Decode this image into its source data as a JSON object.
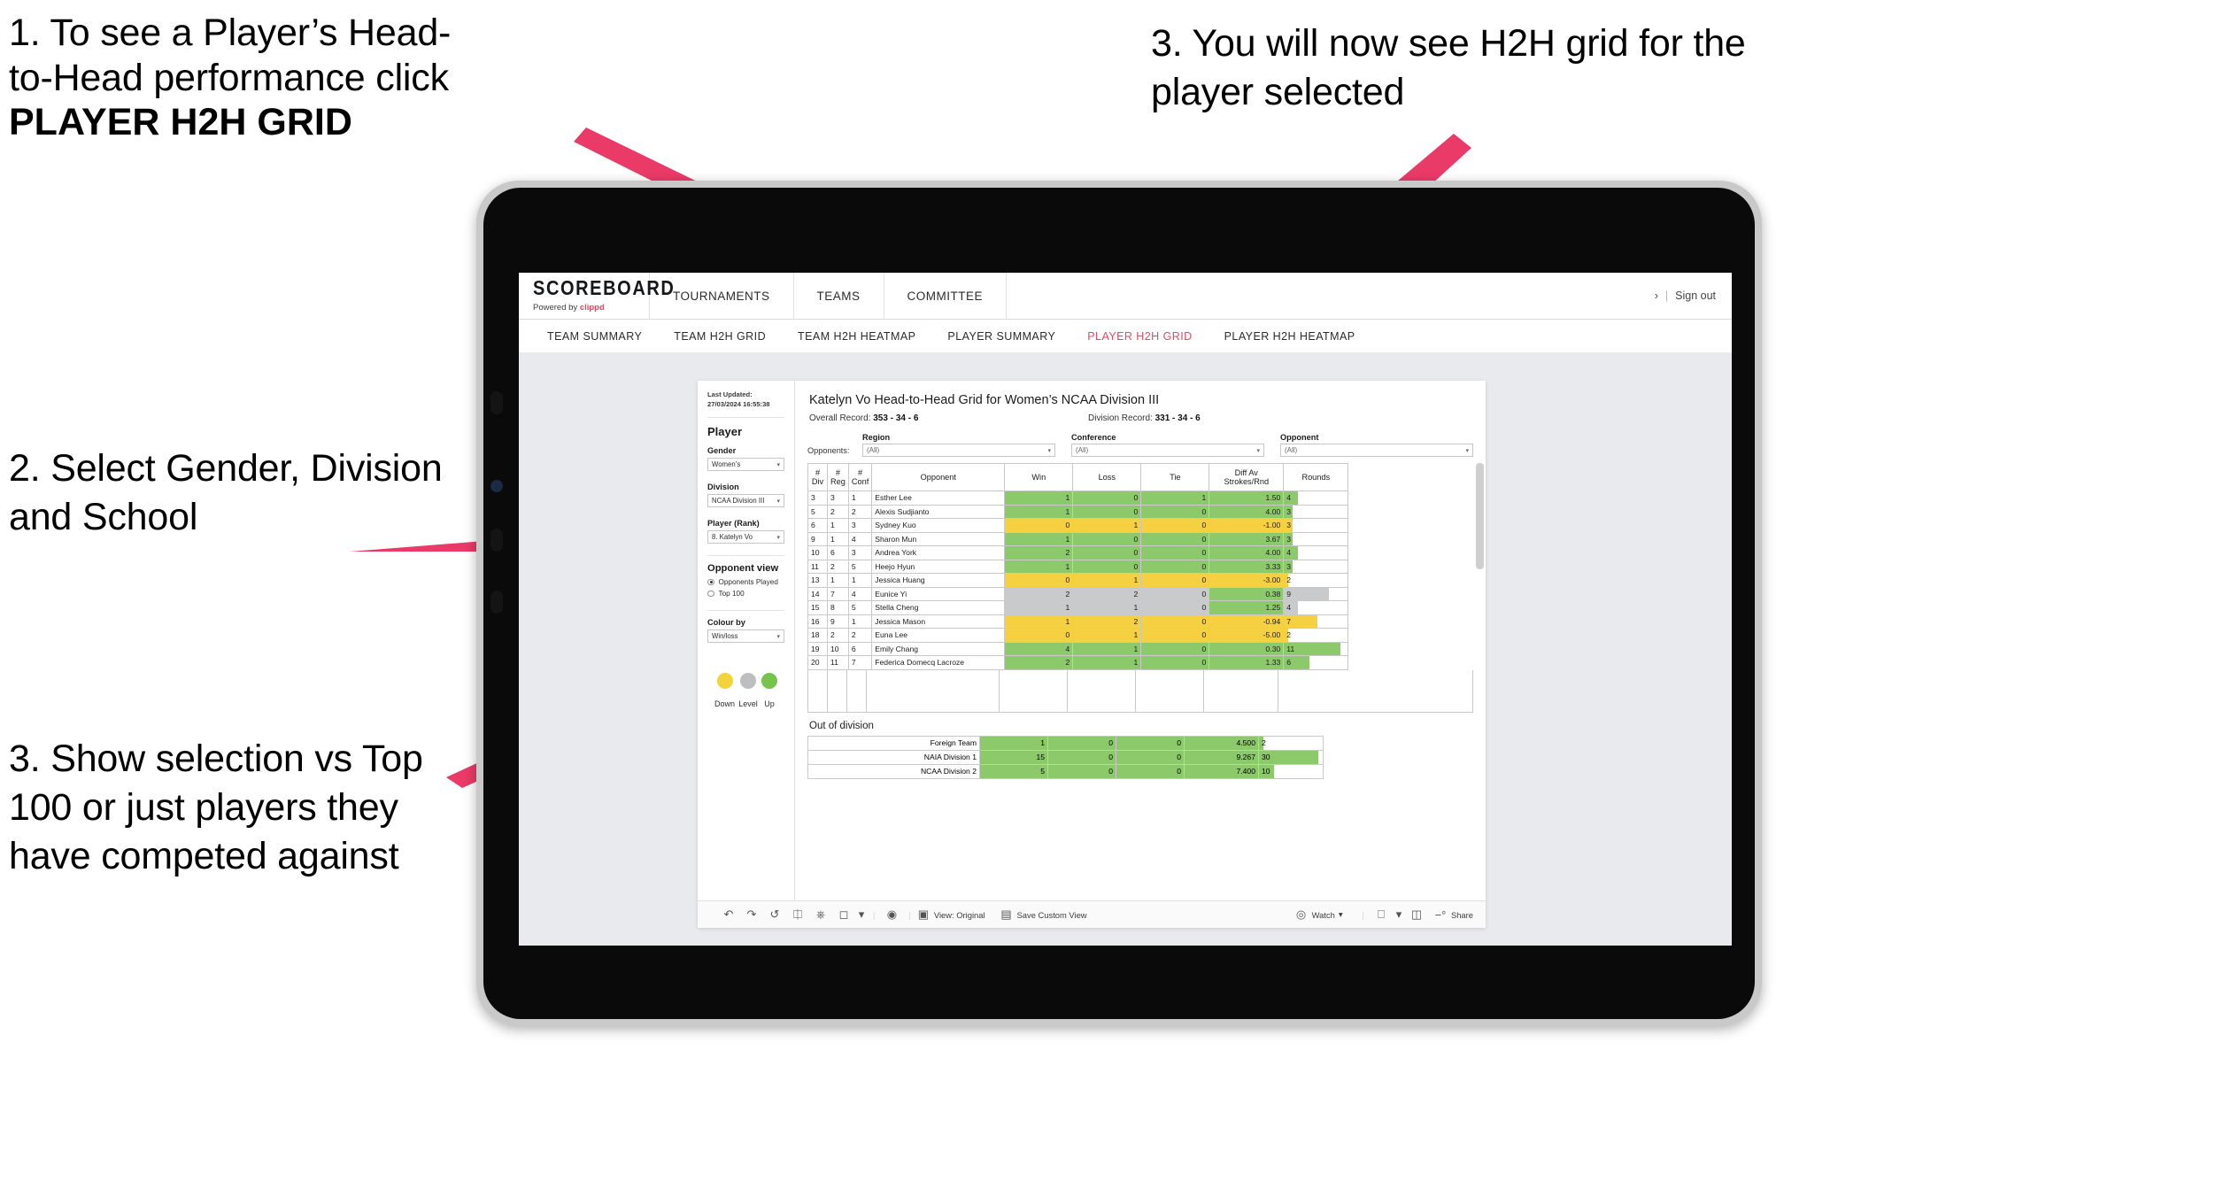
{
  "annotations": {
    "note1_line1": "1. To see a Player’s Head-",
    "note1_line2": "to-Head performance click",
    "note1_bold": "PLAYER H2H GRID",
    "note2": "2. Select Gender, Division and School",
    "note3_left": "3. Show selection vs Top 100 or just players they have competed against",
    "note3_top": "3. You will now see H2H grid for the player selected",
    "arrow_color": "#ea3a68"
  },
  "app": {
    "logo_main": "SCOREBOARD",
    "logo_sub_prefix": "Powered by",
    "logo_sub_brand": "clippd",
    "topnav": [
      "TOURNAMENTS",
      "TEAMS",
      "COMMITTEE"
    ],
    "account_chevron": "›",
    "account_sep": "|",
    "sign_out": "Sign out",
    "subnav": [
      {
        "label": "TEAM SUMMARY",
        "active": false
      },
      {
        "label": "TEAM H2H GRID",
        "active": false
      },
      {
        "label": "TEAM H2H HEATMAP",
        "active": false
      },
      {
        "label": "PLAYER SUMMARY",
        "active": false
      },
      {
        "label": "PLAYER H2H GRID",
        "active": true
      },
      {
        "label": "PLAYER H2H HEATMAP",
        "active": false
      }
    ],
    "active_tab_color": "#ec4464"
  },
  "sidebar": {
    "last_updated": "Last Updated: 27/03/2024 16:55:38",
    "player_heading": "Player",
    "gender_label": "Gender",
    "gender_value": "Women’s",
    "division_label": "Division",
    "division_value": "NCAA Division III",
    "player_label": "Player (Rank)",
    "player_value": "8. Katelyn Vo",
    "opponent_view_heading": "Opponent view",
    "radio_opponents_played": "Opponents Played",
    "radio_top100": "Top 100",
    "colour_by_label": "Colour by",
    "colour_by_value": "Win/loss",
    "legend": [
      {
        "label": "Down",
        "color": "#f2d33c"
      },
      {
        "label": "Level",
        "color": "#bcbec0"
      },
      {
        "label": "Up",
        "color": "#76c34e"
      }
    ],
    "chevron": "▾"
  },
  "main": {
    "title": "Katelyn Vo Head-to-Head Grid for Women’s NCAA Division III",
    "overall_label": "Overall Record:",
    "overall_value": "353 - 34 - 6",
    "division_label": "Division Record:",
    "division_value": "331 - 34 - 6",
    "opponents_label": "Opponents:",
    "filters": [
      {
        "label": "Region",
        "value": "(All)"
      },
      {
        "label": "Conference",
        "value": "(All)"
      },
      {
        "label": "Opponent",
        "value": "(All)"
      }
    ],
    "out_of_division_label": "Out of division"
  },
  "chart_data": {
    "type": "table",
    "title": "Katelyn Vo Head-to-Head Grid for Women’s NCAA Division III",
    "columns": [
      "# Div",
      "# Reg",
      "# Conf",
      "Opponent",
      "Win",
      "Loss",
      "Tie",
      "Diff Av Strokes/Rnd",
      "Rounds"
    ],
    "column_header_lines": [
      [
        "#",
        "Div"
      ],
      [
        "#",
        "Reg"
      ],
      [
        "#",
        "Conf"
      ],
      [
        "Opponent",
        ""
      ],
      [
        "Win",
        ""
      ],
      [
        "Loss",
        ""
      ],
      [
        "Tie",
        ""
      ],
      [
        "Diff Av",
        "Strokes/Rnd"
      ],
      [
        "Rounds",
        ""
      ]
    ],
    "rows": [
      {
        "div": "3",
        "reg": "3",
        "conf": "1",
        "opponent": "Esther Lee",
        "win": "1",
        "loss": "0",
        "tie": "1",
        "diff": "1.50",
        "rounds": "4",
        "state": "up",
        "bar_pct": 22
      },
      {
        "div": "5",
        "reg": "2",
        "conf": "2",
        "opponent": "Alexis Sudjianto",
        "win": "1",
        "loss": "0",
        "tie": "0",
        "diff": "4.00",
        "rounds": "3",
        "state": "up",
        "bar_pct": 14
      },
      {
        "div": "6",
        "reg": "1",
        "conf": "3",
        "opponent": "Sydney Kuo",
        "win": "0",
        "loss": "1",
        "tie": "0",
        "diff": "-1.00",
        "rounds": "3",
        "state": "down",
        "bar_pct": 14
      },
      {
        "div": "9",
        "reg": "1",
        "conf": "4",
        "opponent": "Sharon Mun",
        "win": "1",
        "loss": "0",
        "tie": "0",
        "diff": "3.67",
        "rounds": "3",
        "state": "up",
        "bar_pct": 14
      },
      {
        "div": "10",
        "reg": "6",
        "conf": "3",
        "opponent": "Andrea York",
        "win": "2",
        "loss": "0",
        "tie": "0",
        "diff": "4.00",
        "rounds": "4",
        "state": "up",
        "bar_pct": 22
      },
      {
        "div": "11",
        "reg": "2",
        "conf": "5",
        "opponent": "Heejo Hyun",
        "win": "1",
        "loss": "0",
        "tie": "0",
        "diff": "3.33",
        "rounds": "3",
        "state": "up",
        "bar_pct": 14
      },
      {
        "div": "13",
        "reg": "1",
        "conf": "1",
        "opponent": "Jessica Huang",
        "win": "0",
        "loss": "1",
        "tie": "0",
        "diff": "-3.00",
        "rounds": "2",
        "state": "down",
        "bar_pct": 7
      },
      {
        "div": "14",
        "reg": "7",
        "conf": "4",
        "opponent": "Eunice Yi",
        "win": "2",
        "loss": "2",
        "tie": "0",
        "diff": "0.38",
        "rounds": "9",
        "state": "level",
        "bar_pct": 70
      },
      {
        "div": "15",
        "reg": "8",
        "conf": "5",
        "opponent": "Stella Cheng",
        "win": "1",
        "loss": "1",
        "tie": "0",
        "diff": "1.25",
        "rounds": "4",
        "state": "level",
        "bar_pct": 22
      },
      {
        "div": "16",
        "reg": "9",
        "conf": "1",
        "opponent": "Jessica Mason",
        "win": "1",
        "loss": "2",
        "tie": "0",
        "diff": "-0.94",
        "rounds": "7",
        "state": "down",
        "bar_pct": 52
      },
      {
        "div": "18",
        "reg": "2",
        "conf": "2",
        "opponent": "Euna Lee",
        "win": "0",
        "loss": "1",
        "tie": "0",
        "diff": "-5.00",
        "rounds": "2",
        "state": "down",
        "bar_pct": 7
      },
      {
        "div": "19",
        "reg": "10",
        "conf": "6",
        "opponent": "Emily Chang",
        "win": "4",
        "loss": "1",
        "tie": "0",
        "diff": "0.30",
        "rounds": "11",
        "state": "up",
        "bar_pct": 88
      },
      {
        "div": "20",
        "reg": "11",
        "conf": "7",
        "opponent": "Federica Domecq Lacroze",
        "win": "2",
        "loss": "1",
        "tie": "0",
        "diff": "1.33",
        "rounds": "6",
        "state": "up",
        "bar_pct": 40
      }
    ],
    "out_of_division": [
      {
        "name": "Foreign Team",
        "win": "1",
        "loss": "0",
        "tie": "0",
        "diff": "4.500",
        "rounds": "2",
        "state": "up",
        "bar_pct": 7
      },
      {
        "name": "NAIA Division 1",
        "win": "15",
        "loss": "0",
        "tie": "0",
        "diff": "9.267",
        "rounds": "30",
        "state": "up",
        "bar_pct": 93
      },
      {
        "name": "NCAA Division 2",
        "win": "5",
        "loss": "0",
        "tie": "0",
        "diff": "7.400",
        "rounds": "10",
        "state": "up",
        "bar_pct": 24
      }
    ],
    "colors": {
      "up": "#8bc96a",
      "down": "#f5d142",
      "level": "#c9cacb",
      "neutral": "#ffffff"
    }
  },
  "vizbar": {
    "view_label": "View: Original",
    "save_label": "Save Custom View",
    "watch_label": "Watch",
    "share_label": "Share",
    "chevron": "▾"
  }
}
